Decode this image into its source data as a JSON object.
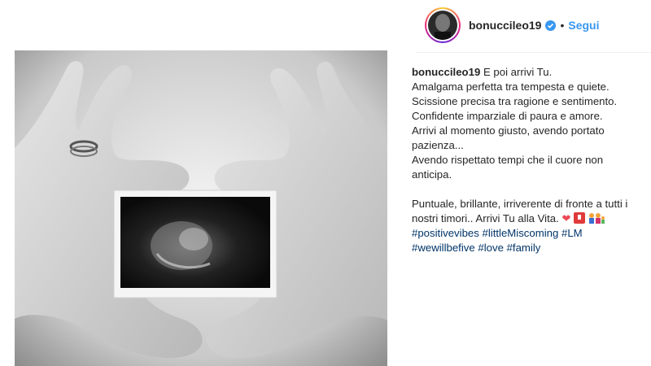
{
  "post": {
    "username": "bonuccileo19",
    "separator": "•",
    "follow_label": "Segui"
  },
  "caption": {
    "author": "bonuccileo19",
    "lines": [
      "E poi arrivi Tu.",
      "Amalgama perfetta tra tempesta e quiete.",
      "Scissione precisa tra ragione e sentimento.",
      "Confidente imparziale di paura e amore.",
      "Arrivi al momento giusto, avendo portato",
      "pazienza...",
      "Avendo rispettato tempi che il cuore non",
      "anticipa.",
      "Puntuale, brillante, irriverente di fronte a tutti i",
      "nostri timori.. Arrivi Tu alla Vita."
    ],
    "hashtags_line1": [
      "#positivevibes",
      "#littleMiscoming",
      "#LM"
    ],
    "hashtags_line2": [
      "#wewillbefive",
      "#love",
      "#family"
    ],
    "heart_emoji": "❤"
  },
  "colors": {
    "accent": "#3897f0",
    "hashtag": "#003569",
    "text": "#262626"
  },
  "icons": [
    "verified-badge-icon",
    "heart-emoji-icon",
    "baby-emoji-icon",
    "family-emoji-icon"
  ]
}
